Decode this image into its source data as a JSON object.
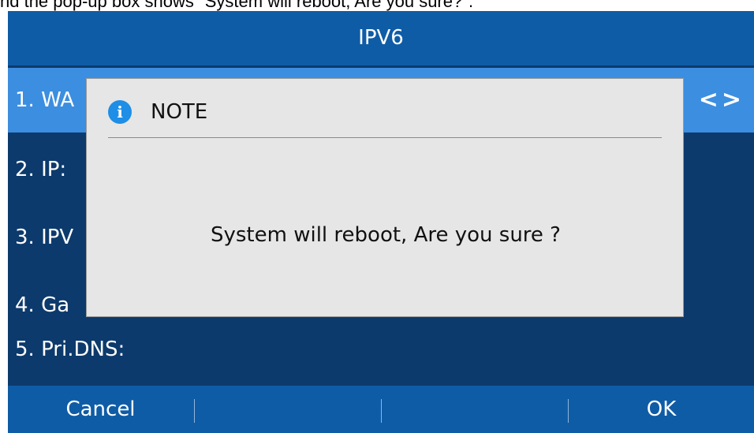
{
  "caption": "nd the pop-up box shows \"System will reboot, Are you sure?\".",
  "screen": {
    "title": "IPV6",
    "menu_items": [
      {
        "label": "1. WA"
      },
      {
        "label": "2. IP:"
      },
      {
        "label": "3. IPV"
      },
      {
        "label": "4. Ga"
      },
      {
        "label": "5. Pri.DNS:"
      }
    ],
    "selected_index": 0,
    "nav_arrows": "<>",
    "softkeys": [
      {
        "label": "Cancel"
      },
      {
        "label": ""
      },
      {
        "label": ""
      },
      {
        "label": "OK"
      }
    ]
  },
  "dialog": {
    "icon": "info-icon",
    "icon_glyph": "i",
    "title": "NOTE",
    "message": "System will reboot, Are you sure ?"
  },
  "colors": {
    "title_bar": "#0f5ca6",
    "list_bg": "#0d3a6c",
    "selected_row": "#3c8ee0",
    "dialog_bg": "#e6e6e6",
    "info_icon": "#1e8ee6"
  }
}
